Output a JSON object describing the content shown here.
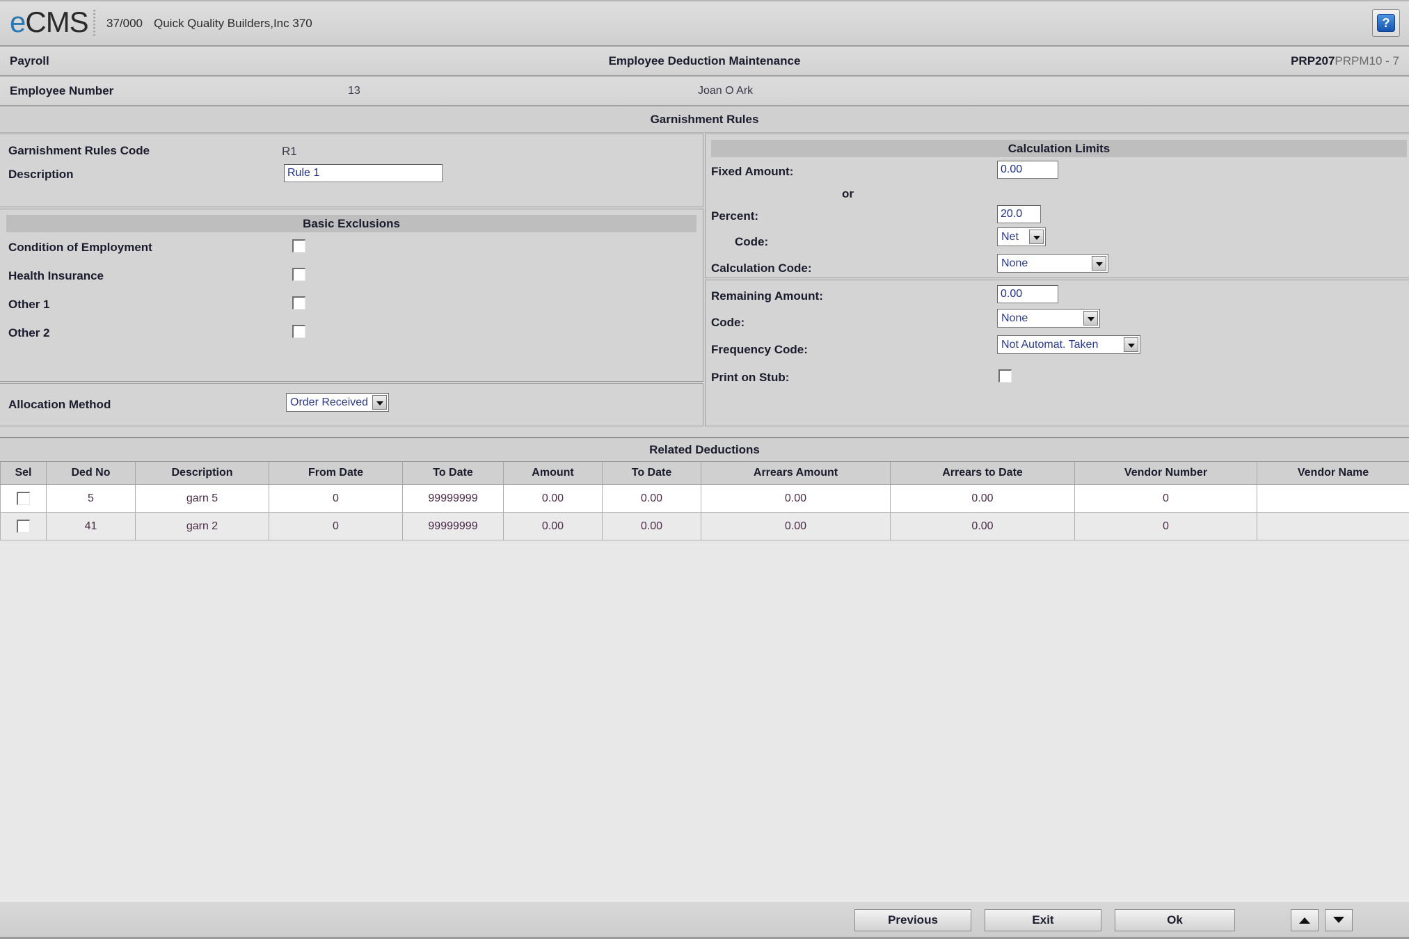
{
  "brand": {
    "logo_e": "e",
    "logo_rest": "CMS",
    "company_id": "37/000",
    "company_name": "Quick Quality Builders,Inc 370",
    "help_icon": "question-mark-icon",
    "help_glyph": "?"
  },
  "titlebar": {
    "module": "Payroll",
    "screen_title": "Employee Deduction Maintenance",
    "program_id": "PRP207",
    "program_sub": "PRPM10 - 7"
  },
  "employee": {
    "label": "Employee Number",
    "number": "13",
    "name": "Joan O Ark"
  },
  "section_band": {
    "title": "Garnishment Rules"
  },
  "left_panel": {
    "rules_code_label": "Garnishment Rules Code",
    "rules_code_value": "R1",
    "description_label": "Description",
    "description_value": "Rule 1",
    "basic_exclusions_header": "Basic Exclusions",
    "exclusions": [
      {
        "label": "Condition of Employment",
        "checked": false
      },
      {
        "label": "Health Insurance",
        "checked": false
      },
      {
        "label": "Other 1",
        "checked": false
      },
      {
        "label": "Other 2",
        "checked": false
      }
    ],
    "allocation_method_label": "Allocation Method",
    "allocation_method_value": "Order Received"
  },
  "right_panel": {
    "calc_limits_header": "Calculation Limits",
    "fixed_amount_label": "Fixed Amount:",
    "fixed_amount_value": "0.00",
    "or_label": "or",
    "percent_label": "Percent:",
    "percent_value": "20.0",
    "percent_code_label": "Code:",
    "percent_code_value": "Net",
    "calculation_code_label": "Calculation Code:",
    "calculation_code_value": "None",
    "remaining_amount_label": "Remaining Amount:",
    "remaining_amount_value": "0.00",
    "remaining_code_label": "Code:",
    "remaining_code_value": "None",
    "frequency_code_label": "Frequency Code:",
    "frequency_code_value": "Not Automat. Taken",
    "print_on_stub_label": "Print on Stub:",
    "print_on_stub_checked": false
  },
  "related_deductions": {
    "header": "Related Deductions",
    "columns": [
      "Sel",
      "Ded No",
      "Description",
      "From Date",
      "To Date",
      "Amount",
      "To Date",
      "Arrears Amount",
      "Arrears to Date",
      "Vendor Number",
      "Vendor Name"
    ],
    "rows": [
      {
        "sel": false,
        "ded_no": "5",
        "description": "garn 5",
        "from_date": "0",
        "to_date": "99999999",
        "amount": "0.00",
        "amount_to_date": "0.00",
        "arrears_amount": "0.00",
        "arrears_to_date": "0.00",
        "vendor_number": "0",
        "vendor_name": ""
      },
      {
        "sel": false,
        "ded_no": "41",
        "description": "garn 2",
        "from_date": "0",
        "to_date": "99999999",
        "amount": "0.00",
        "amount_to_date": "0.00",
        "arrears_amount": "0.00",
        "arrears_to_date": "0.00",
        "vendor_number": "0",
        "vendor_name": ""
      }
    ]
  },
  "buttons": {
    "previous": "Previous",
    "exit": "Exit",
    "ok": "Ok",
    "scroll_up_icon": "triangle-up-icon",
    "scroll_down_icon": "triangle-down-icon"
  },
  "colors": {
    "accent_blue": "#2878b5",
    "field_text": "#2a3a8a",
    "panel_bg": "#d4d4d4",
    "subhead_bg": "#bebebe",
    "body_bg": "#e8e8e8"
  }
}
